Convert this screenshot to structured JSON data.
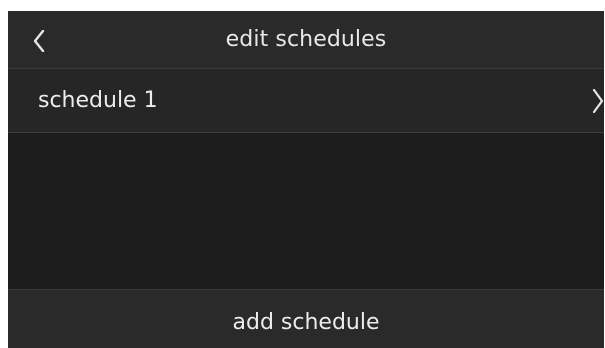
{
  "header": {
    "title": "edit schedules",
    "back_icon": "chevron-left-icon"
  },
  "schedules": {
    "items": [
      {
        "label": "schedule 1",
        "icon": "chevron-right-icon"
      }
    ]
  },
  "footer": {
    "add_label": "add schedule"
  },
  "colors": {
    "background": "#1d1d1d",
    "bar": "#2a2a2a",
    "text": "#ececec"
  }
}
